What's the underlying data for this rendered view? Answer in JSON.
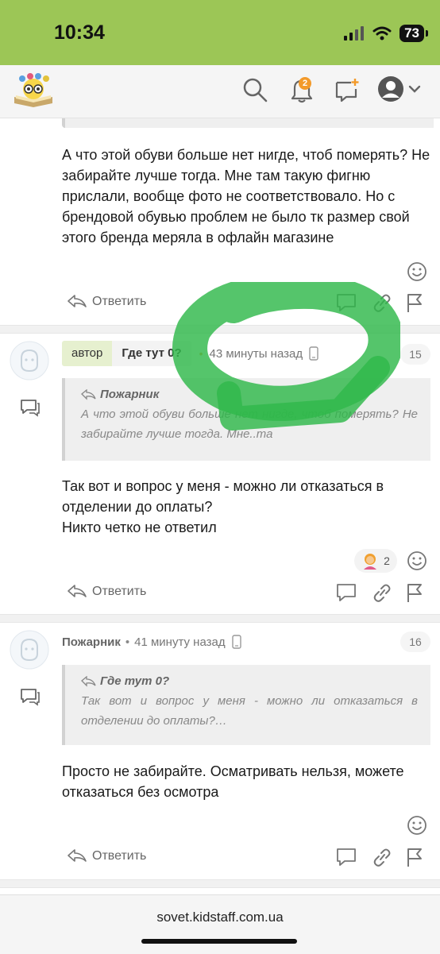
{
  "status_bar": {
    "time": "10:34",
    "battery": "73"
  },
  "header": {
    "notifications_count": "2"
  },
  "post_prev": {
    "text": "А что этой обуви больше нет нигде, чтоб померять? Не забирайте лучше тогда. Мне там такую фигню прислали, вообще фото не соответствовало. Но с брендовой обувью проблем не было тк размер свой этого бренда меряла в офлайн магазине",
    "reply_label": "Ответить"
  },
  "post_15": {
    "author_tag": "автор",
    "username": "Где тут 0?",
    "time": "43 минуты назад",
    "number": "15",
    "quote_author": "Пожарник",
    "quote_text": "А что этой обуви больше нет нигде, чтоб померять? Не забирайте лучше тогда. Мне..та",
    "text": "Так вот и вопрос у меня - можно ли отказаться в отделении до оплаты?\nНикто четко не ответил",
    "reaction_count": "2",
    "reply_label": "Ответить"
  },
  "post_16": {
    "username": "Пожарник",
    "time": "41 минуту назад",
    "number": "16",
    "quote_author": "Где тут 0?",
    "quote_text": "Так вот и вопрос у меня - можно ли отказаться в отделении до оплаты?…",
    "text": "Просто не забирайте. Осматривать нельзя, можете отказаться без осмотра",
    "reply_label": "Ответить"
  },
  "footer": {
    "url": "sovet.kidstaff.com.ua"
  },
  "colors": {
    "status_bar": "#9cc656",
    "highlight": "#2fb84a",
    "badge": "#f39a2a"
  }
}
